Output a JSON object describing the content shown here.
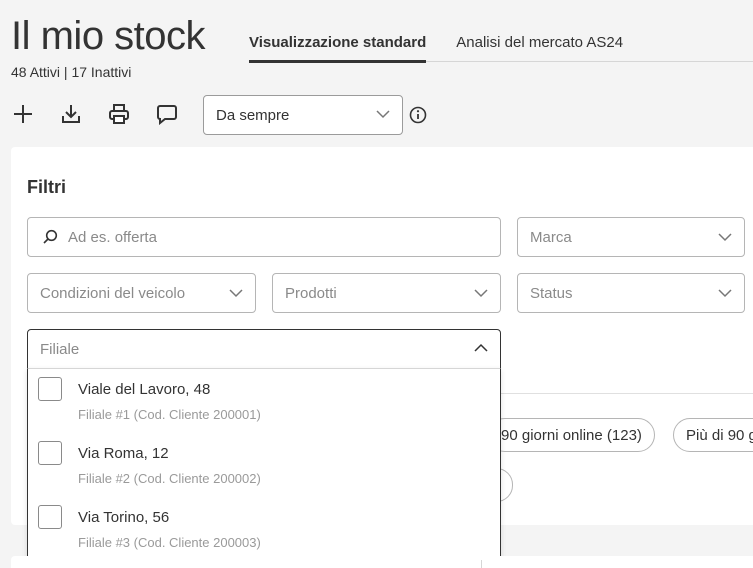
{
  "header": {
    "title": "Il mio stock",
    "counts": "48 Attivi  |  17 Inattivi"
  },
  "tabs": [
    {
      "label": "Visualizzazione standard",
      "active": true
    },
    {
      "label": "Analisi del mercato AS24",
      "active": false
    }
  ],
  "toolbar": {
    "icons": [
      "plus-icon",
      "download-icon",
      "print-icon",
      "comment-icon"
    ],
    "period": "Da sempre"
  },
  "filters": {
    "title": "Filtri",
    "search_placeholder": "Ad es. offerta",
    "brand": "Marca",
    "condition": "Condizioni del veicolo",
    "products": "Prodotti",
    "status": "Status",
    "branch": "Filiale"
  },
  "branch_options": [
    {
      "name": "Viale del Lavoro, 48",
      "detail": "Filiale #1 (Cod. Cliente 200001)",
      "checked": false
    },
    {
      "name": "Via Roma, 12",
      "detail": "Filiale #2 (Cod. Cliente 200002)",
      "checked": false
    },
    {
      "name": "Via Torino, 56",
      "detail": "Filiale #3 (Cod. Cliente 200003)",
      "checked": false
    }
  ],
  "chips": {
    "online_90": "90 giorni online (123)",
    "more_90": "Più di 90 g",
    "partial": ")"
  },
  "colors": {
    "text": "#333333",
    "border": "#b5b5b5",
    "placeholder": "#8a8a8a",
    "background": "#f4f4f4"
  }
}
